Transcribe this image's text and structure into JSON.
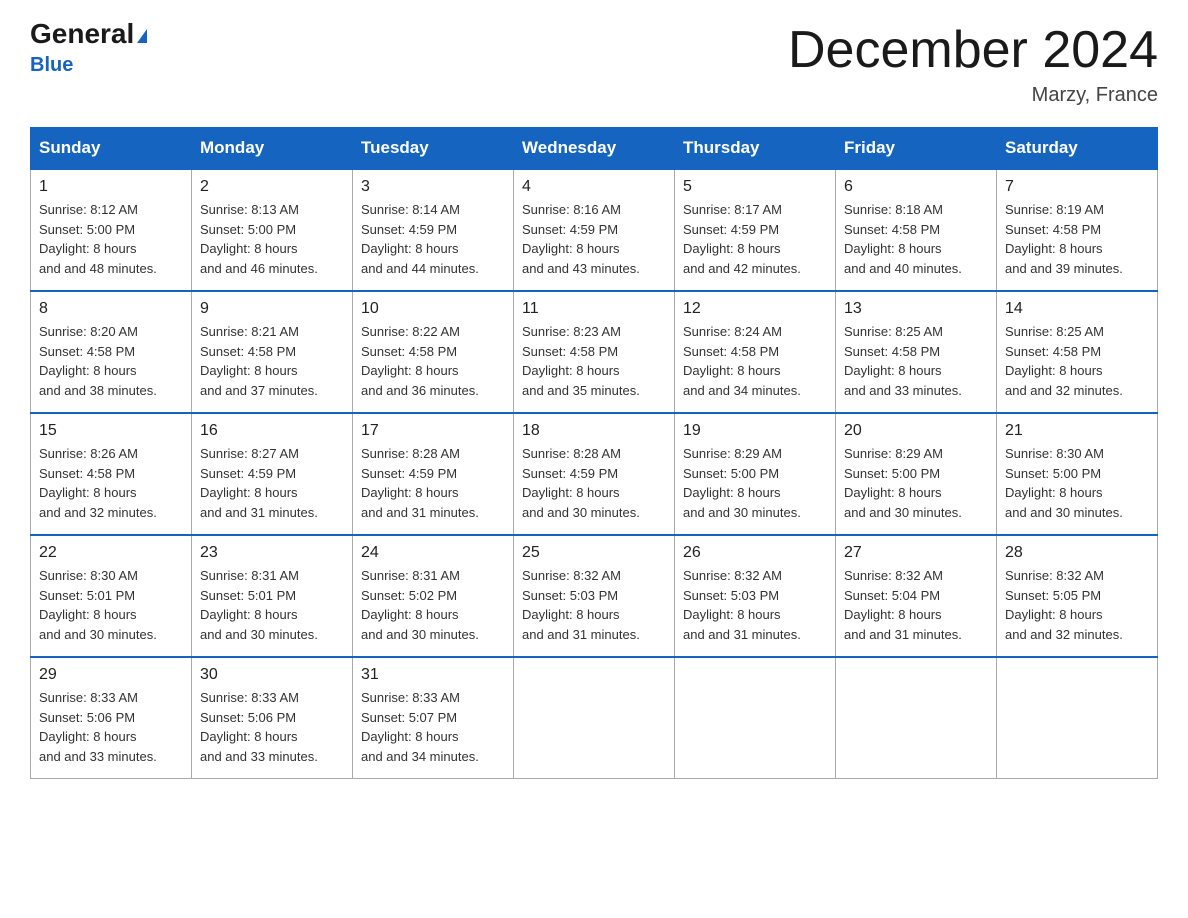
{
  "header": {
    "logo_general": "General",
    "logo_blue": "Blue",
    "month_title": "December 2024",
    "location": "Marzy, France"
  },
  "days_of_week": [
    "Sunday",
    "Monday",
    "Tuesday",
    "Wednesday",
    "Thursday",
    "Friday",
    "Saturday"
  ],
  "weeks": [
    [
      {
        "day": "1",
        "sunrise": "8:12 AM",
        "sunset": "5:00 PM",
        "daylight": "8 hours and 48 minutes."
      },
      {
        "day": "2",
        "sunrise": "8:13 AM",
        "sunset": "5:00 PM",
        "daylight": "8 hours and 46 minutes."
      },
      {
        "day": "3",
        "sunrise": "8:14 AM",
        "sunset": "4:59 PM",
        "daylight": "8 hours and 44 minutes."
      },
      {
        "day": "4",
        "sunrise": "8:16 AM",
        "sunset": "4:59 PM",
        "daylight": "8 hours and 43 minutes."
      },
      {
        "day": "5",
        "sunrise": "8:17 AM",
        "sunset": "4:59 PM",
        "daylight": "8 hours and 42 minutes."
      },
      {
        "day": "6",
        "sunrise": "8:18 AM",
        "sunset": "4:58 PM",
        "daylight": "8 hours and 40 minutes."
      },
      {
        "day": "7",
        "sunrise": "8:19 AM",
        "sunset": "4:58 PM",
        "daylight": "8 hours and 39 minutes."
      }
    ],
    [
      {
        "day": "8",
        "sunrise": "8:20 AM",
        "sunset": "4:58 PM",
        "daylight": "8 hours and 38 minutes."
      },
      {
        "day": "9",
        "sunrise": "8:21 AM",
        "sunset": "4:58 PM",
        "daylight": "8 hours and 37 minutes."
      },
      {
        "day": "10",
        "sunrise": "8:22 AM",
        "sunset": "4:58 PM",
        "daylight": "8 hours and 36 minutes."
      },
      {
        "day": "11",
        "sunrise": "8:23 AM",
        "sunset": "4:58 PM",
        "daylight": "8 hours and 35 minutes."
      },
      {
        "day": "12",
        "sunrise": "8:24 AM",
        "sunset": "4:58 PM",
        "daylight": "8 hours and 34 minutes."
      },
      {
        "day": "13",
        "sunrise": "8:25 AM",
        "sunset": "4:58 PM",
        "daylight": "8 hours and 33 minutes."
      },
      {
        "day": "14",
        "sunrise": "8:25 AM",
        "sunset": "4:58 PM",
        "daylight": "8 hours and 32 minutes."
      }
    ],
    [
      {
        "day": "15",
        "sunrise": "8:26 AM",
        "sunset": "4:58 PM",
        "daylight": "8 hours and 32 minutes."
      },
      {
        "day": "16",
        "sunrise": "8:27 AM",
        "sunset": "4:59 PM",
        "daylight": "8 hours and 31 minutes."
      },
      {
        "day": "17",
        "sunrise": "8:28 AM",
        "sunset": "4:59 PM",
        "daylight": "8 hours and 31 minutes."
      },
      {
        "day": "18",
        "sunrise": "8:28 AM",
        "sunset": "4:59 PM",
        "daylight": "8 hours and 30 minutes."
      },
      {
        "day": "19",
        "sunrise": "8:29 AM",
        "sunset": "5:00 PM",
        "daylight": "8 hours and 30 minutes."
      },
      {
        "day": "20",
        "sunrise": "8:29 AM",
        "sunset": "5:00 PM",
        "daylight": "8 hours and 30 minutes."
      },
      {
        "day": "21",
        "sunrise": "8:30 AM",
        "sunset": "5:00 PM",
        "daylight": "8 hours and 30 minutes."
      }
    ],
    [
      {
        "day": "22",
        "sunrise": "8:30 AM",
        "sunset": "5:01 PM",
        "daylight": "8 hours and 30 minutes."
      },
      {
        "day": "23",
        "sunrise": "8:31 AM",
        "sunset": "5:01 PM",
        "daylight": "8 hours and 30 minutes."
      },
      {
        "day": "24",
        "sunrise": "8:31 AM",
        "sunset": "5:02 PM",
        "daylight": "8 hours and 30 minutes."
      },
      {
        "day": "25",
        "sunrise": "8:32 AM",
        "sunset": "5:03 PM",
        "daylight": "8 hours and 31 minutes."
      },
      {
        "day": "26",
        "sunrise": "8:32 AM",
        "sunset": "5:03 PM",
        "daylight": "8 hours and 31 minutes."
      },
      {
        "day": "27",
        "sunrise": "8:32 AM",
        "sunset": "5:04 PM",
        "daylight": "8 hours and 31 minutes."
      },
      {
        "day": "28",
        "sunrise": "8:32 AM",
        "sunset": "5:05 PM",
        "daylight": "8 hours and 32 minutes."
      }
    ],
    [
      {
        "day": "29",
        "sunrise": "8:33 AM",
        "sunset": "5:06 PM",
        "daylight": "8 hours and 33 minutes."
      },
      {
        "day": "30",
        "sunrise": "8:33 AM",
        "sunset": "5:06 PM",
        "daylight": "8 hours and 33 minutes."
      },
      {
        "day": "31",
        "sunrise": "8:33 AM",
        "sunset": "5:07 PM",
        "daylight": "8 hours and 34 minutes."
      },
      null,
      null,
      null,
      null
    ]
  ]
}
